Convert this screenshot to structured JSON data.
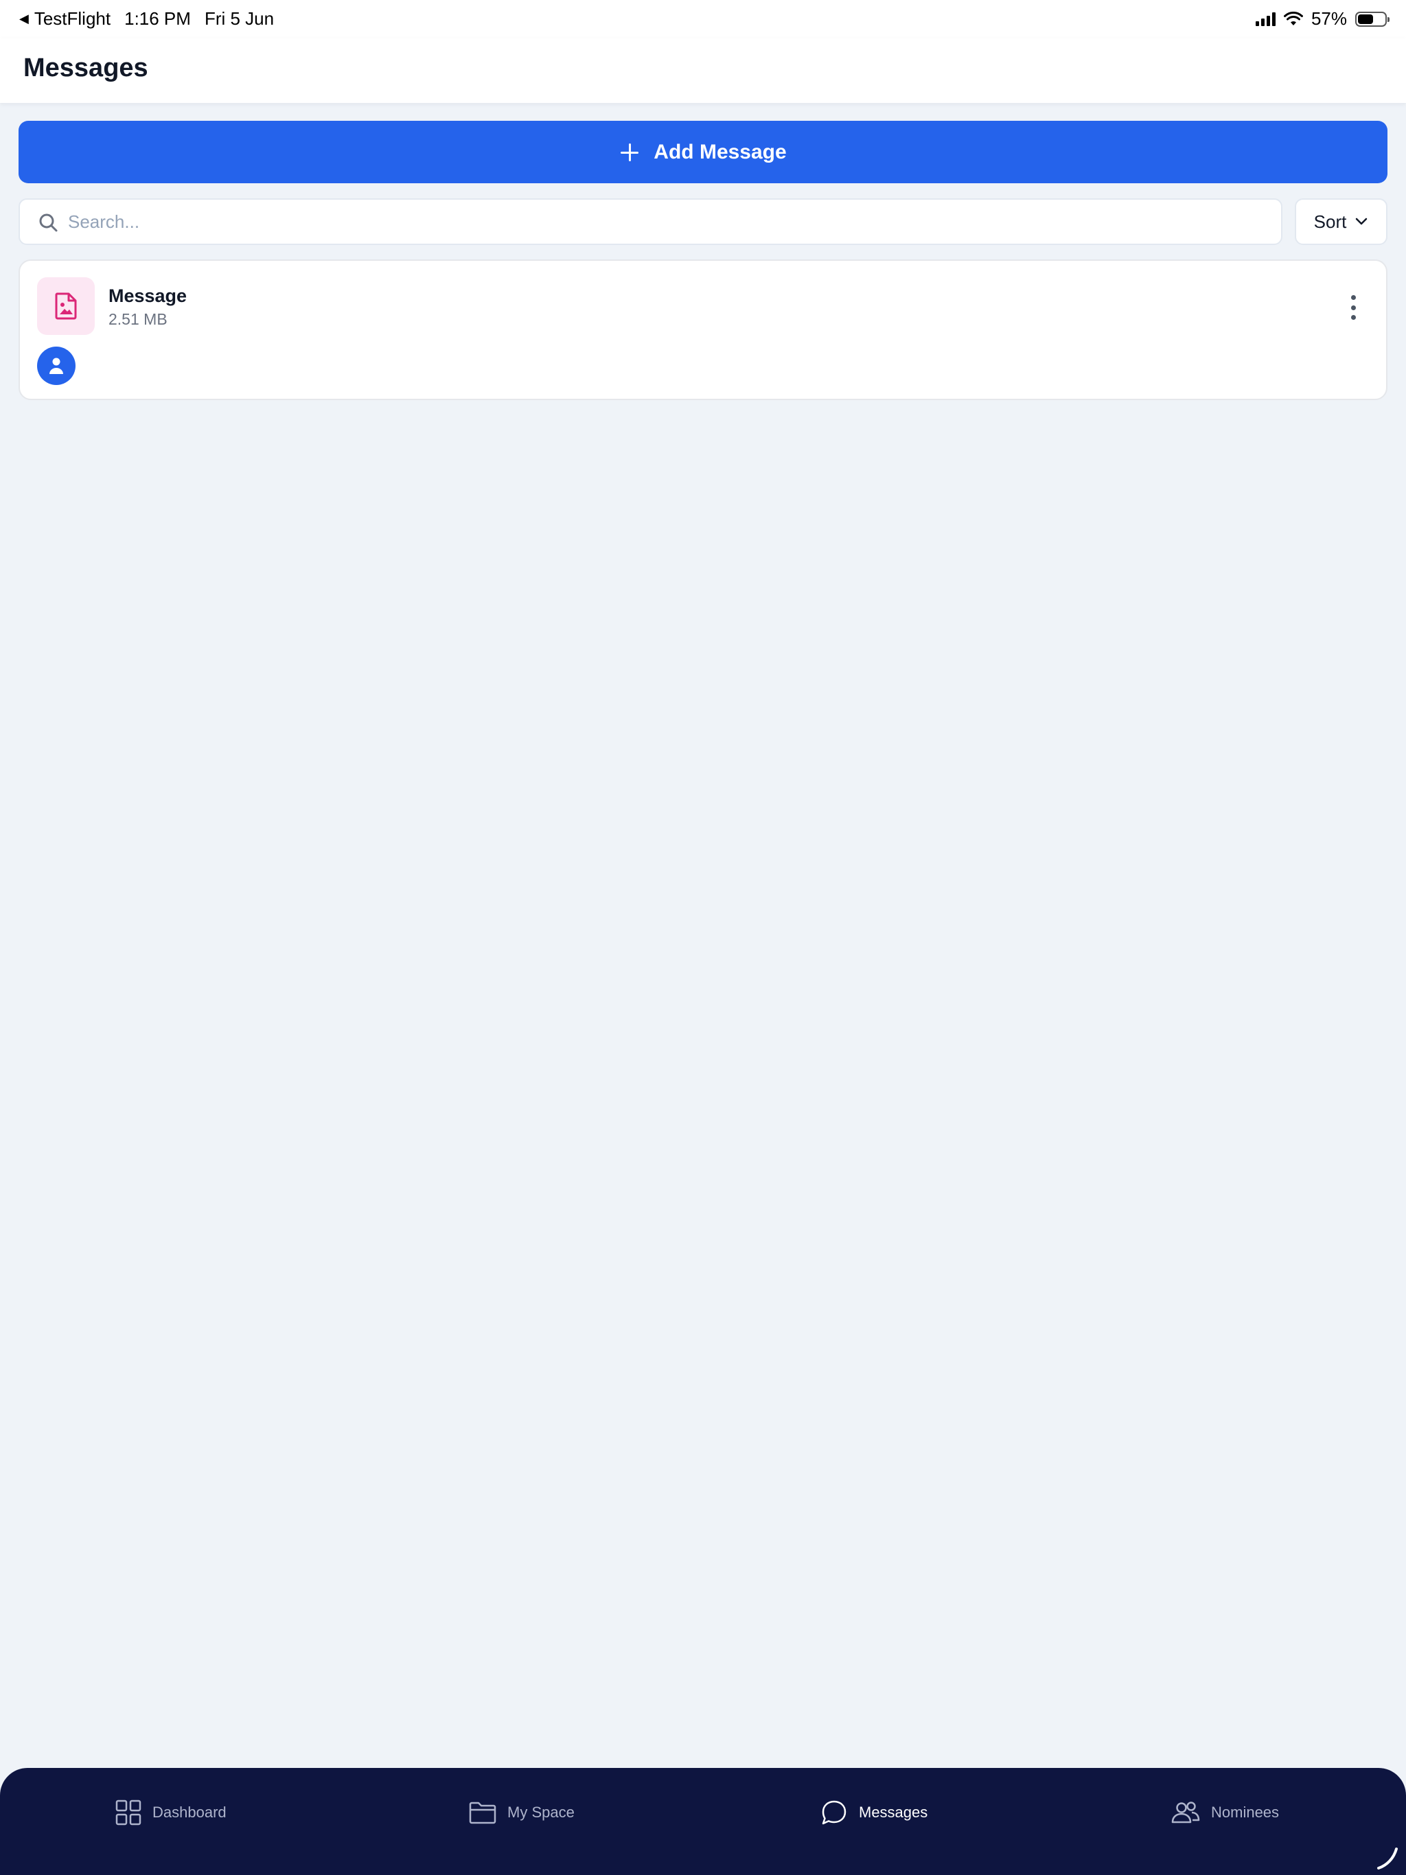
{
  "status_bar": {
    "back_app": "TestFlight",
    "time": "1:16 PM",
    "date": "Fri 5 Jun",
    "battery_percent": "57%",
    "battery_level": 0.57
  },
  "header": {
    "title": "Messages"
  },
  "actions": {
    "add_label": "Add Message",
    "add_icon": "plus-icon"
  },
  "search": {
    "placeholder": "Search...",
    "value": ""
  },
  "sort": {
    "label": "Sort",
    "icon": "chevron-down-icon"
  },
  "messages": [
    {
      "name": "Message",
      "size": "2.51 MB",
      "icon": "image-file-icon",
      "owner_icon": "user-icon"
    }
  ],
  "tabs": [
    {
      "label": "Dashboard",
      "icon": "grid-icon",
      "active": false
    },
    {
      "label": "My Space",
      "icon": "folder-icon",
      "active": false
    },
    {
      "label": "Messages",
      "icon": "chat-bubble-icon",
      "active": true
    },
    {
      "label": "Nominees",
      "icon": "users-icon",
      "active": false
    }
  ],
  "colors": {
    "primary": "#2563eb",
    "background": "#eff3f8",
    "tabbar": "#0e1540",
    "file_icon_bg": "#fce7f3",
    "file_icon_fg": "#db2777"
  }
}
